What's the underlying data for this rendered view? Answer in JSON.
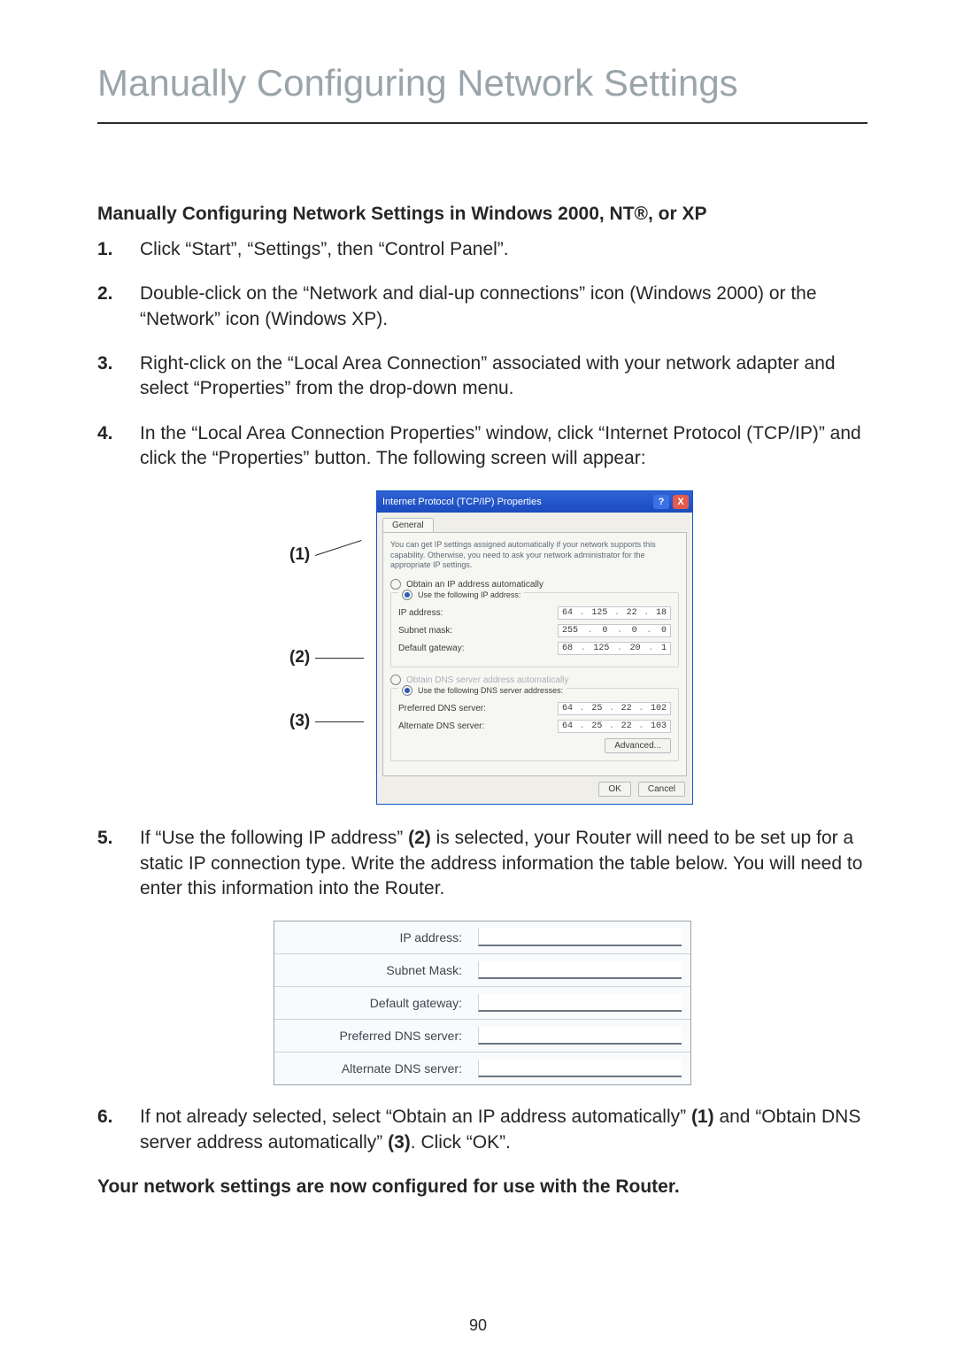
{
  "page_title": "Manually Configuring Network Settings",
  "section_title": "Manually Configuring Network Settings in Windows 2000, NT®, or XP",
  "steps": [
    {
      "n": "1.",
      "text": "Click “Start”, “Settings”, then “Control Panel”."
    },
    {
      "n": "2.",
      "text": "Double-click on the “Network and dial-up connections” icon (Windows 2000) or the “Network” icon (Windows XP)."
    },
    {
      "n": "3.",
      "text": "Right-click on the “Local Area Connection” associated with your network adapter and select “Properties” from the drop-down menu."
    },
    {
      "n": "4.",
      "text": "In the “Local Area Connection Properties” window, click “Internet Protocol (TCP/IP)” and click the “Properties” button. The following screen will appear:"
    }
  ],
  "callouts": {
    "c1": "(1)",
    "c2": "(2)",
    "c3": "(3)"
  },
  "dialog": {
    "title": "Internet Protocol (TCP/IP) Properties",
    "help_glyph": "?",
    "close_glyph": "X",
    "tab": "General",
    "description": "You can get IP settings assigned automatically if your network supports this capability. Otherwise, you need to ask your network administrator for the appropriate IP settings.",
    "radio_auto_ip": "Obtain an IP address automatically",
    "radio_use_ip": "Use the following IP address:",
    "ip_label": "IP address:",
    "ip_value": [
      "64",
      "125",
      "22",
      "18"
    ],
    "subnet_label": "Subnet mask:",
    "subnet_value": [
      "255",
      "0",
      "0",
      "0"
    ],
    "gateway_label": "Default gateway:",
    "gateway_value": [
      "68",
      "125",
      "20",
      "1"
    ],
    "radio_auto_dns": "Obtain DNS server address automatically",
    "radio_use_dns": "Use the following DNS server addresses:",
    "pref_dns_label": "Preferred DNS server:",
    "pref_dns_value": [
      "64",
      "25",
      "22",
      "102"
    ],
    "alt_dns_label": "Alternate DNS server:",
    "alt_dns_value": [
      "64",
      "25",
      "22",
      "103"
    ],
    "advanced": "Advanced...",
    "ok": "OK",
    "cancel": "Cancel"
  },
  "step5": {
    "n": "5.",
    "pre": "If “Use the following IP address” ",
    "bold": "(2)",
    "post": " is selected, your Router will need to be set up for a static IP connection type. Write the address information the table below. You will need to enter this information into the Router."
  },
  "blank_table": {
    "rows": [
      "IP address:",
      "Subnet Mask:",
      "Default gateway:",
      "Preferred DNS server:",
      "Alternate DNS server:"
    ]
  },
  "step6": {
    "n": "6.",
    "t1": "If not already selected, select “Obtain an IP address automatically” ",
    "b1": "(1)",
    "t2": " and “Obtain DNS server address automatically” ",
    "b2": "(3)",
    "t3": ". Click “OK”."
  },
  "closing": "Your network settings are now configured for use with the Router.",
  "page_number": "90"
}
